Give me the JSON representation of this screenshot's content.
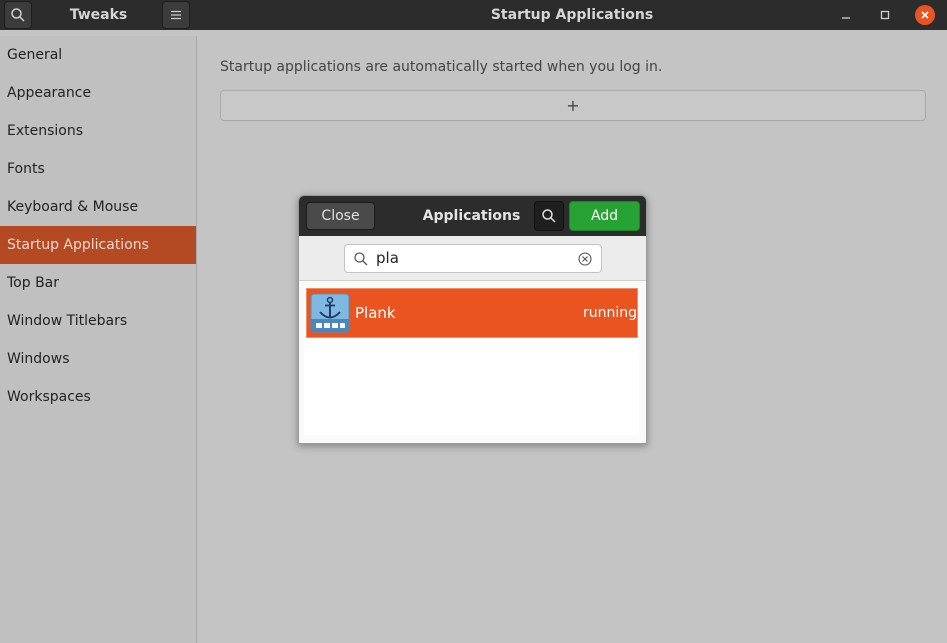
{
  "header": {
    "app_title": "Tweaks",
    "page_title": "Startup Applications"
  },
  "sidebar": {
    "items": [
      {
        "label": "General"
      },
      {
        "label": "Appearance"
      },
      {
        "label": "Extensions"
      },
      {
        "label": "Fonts"
      },
      {
        "label": "Keyboard & Mouse"
      },
      {
        "label": "Startup Applications",
        "active": true
      },
      {
        "label": "Top Bar"
      },
      {
        "label": "Window Titlebars"
      },
      {
        "label": "Windows"
      },
      {
        "label": "Workspaces"
      }
    ]
  },
  "main": {
    "description": "Startup applications are automatically started when you log in.",
    "add_symbol": "+"
  },
  "dialog": {
    "close_label": "Close",
    "title": "Applications",
    "add_label": "Add",
    "search_value": "pla",
    "results": [
      {
        "name": "Plank",
        "status": "running",
        "selected": true
      }
    ]
  },
  "colors": {
    "accent": "#e95420",
    "sidebar_active": "#b44a24",
    "add_button": "#26a334",
    "titlebar": "#2c2c2c"
  },
  "icons": [
    "search-icon",
    "hamburger-menu-icon",
    "minimize-icon",
    "maximize-icon",
    "close-icon",
    "clear-search-icon",
    "plank-anchor-icon"
  ]
}
